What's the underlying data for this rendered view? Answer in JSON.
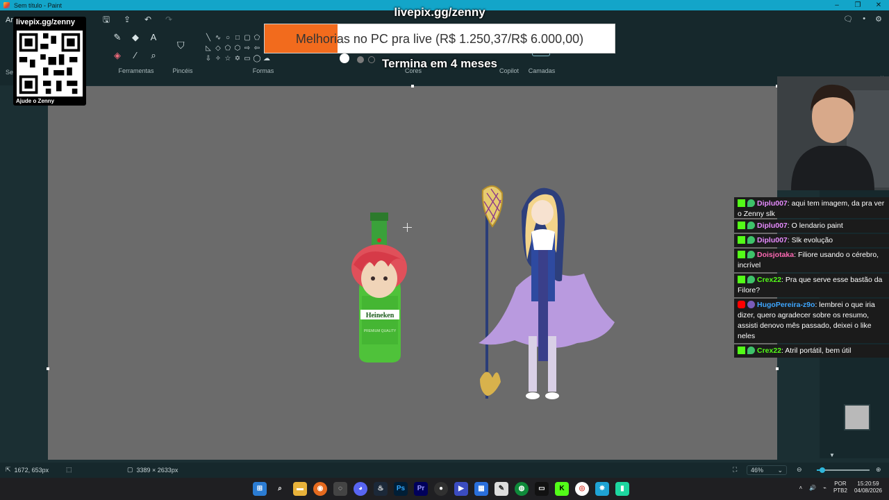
{
  "window": {
    "title": "Sem título - Paint",
    "controls": [
      "–",
      "❐",
      "✕"
    ]
  },
  "ribbon": {
    "file_tab": "Ar",
    "selection_label": "Sel",
    "groups": {
      "tools": "Ferramentas",
      "brushes": "Pincéis",
      "shapes": "Formas",
      "colors": "Cores",
      "copilot": "Copilot",
      "layers": "Camadas"
    }
  },
  "status": {
    "cursor_pos": "1672, 653px",
    "canvas_size": "3389 × 2633px",
    "zoom": "46%",
    "zoom_fraction": 0.1
  },
  "overlay": {
    "qr_url": "livepix.gg/zenny",
    "qr_caption": "Ajude o Zenny",
    "livepix_title": "livepix.gg/zenny",
    "goal_text": "Melhorias no PC pra live (R$ 1.250,37/R$ 6.000,00)",
    "goal_fraction": 0.2084,
    "goal_sub": "Termina em 4 meses",
    "goal_color": "#f26b1d"
  },
  "canvas_art": {
    "bottle_label": "Heineken",
    "bottle_sub": "PREMIUM QUALITY"
  },
  "chat": [
    {
      "platform": "kick",
      "user": "Diplu007",
      "color": "#e78bff",
      "text": "aqui tem imagem, da pra ver o Zenny slk",
      "cut": true
    },
    {
      "platform": "kick",
      "user": "Diplu007",
      "color": "#e78bff",
      "text": "O lendario paint"
    },
    {
      "platform": "kick",
      "user": "Diplu007",
      "color": "#e78bff",
      "text": "Slk evolução"
    },
    {
      "platform": "kick",
      "user": "Doisjotaka",
      "color": "#ff69b4",
      "text": "Filiore usando o cérebro, incrível"
    },
    {
      "platform": "kick",
      "user": "Crex22",
      "color": "#53fc18",
      "text": "Pra que serve esse bastão da Filore?"
    },
    {
      "platform": "youtube",
      "user": "HugoPereira-z9o",
      "color": "#3ea6ff",
      "text": "lembrei o que iria dizer, quero agradecer sobre os resumo, assisti denovo mês passado, deixei o like neles"
    },
    {
      "platform": "kick",
      "user": "Crex22",
      "color": "#53fc18",
      "text": "Atril portátil, bem útil"
    }
  ],
  "taskbar": {
    "lang_top": "POR",
    "lang_bottom": "PTB2",
    "time": "15:20:59",
    "date": "04/08/2026"
  }
}
